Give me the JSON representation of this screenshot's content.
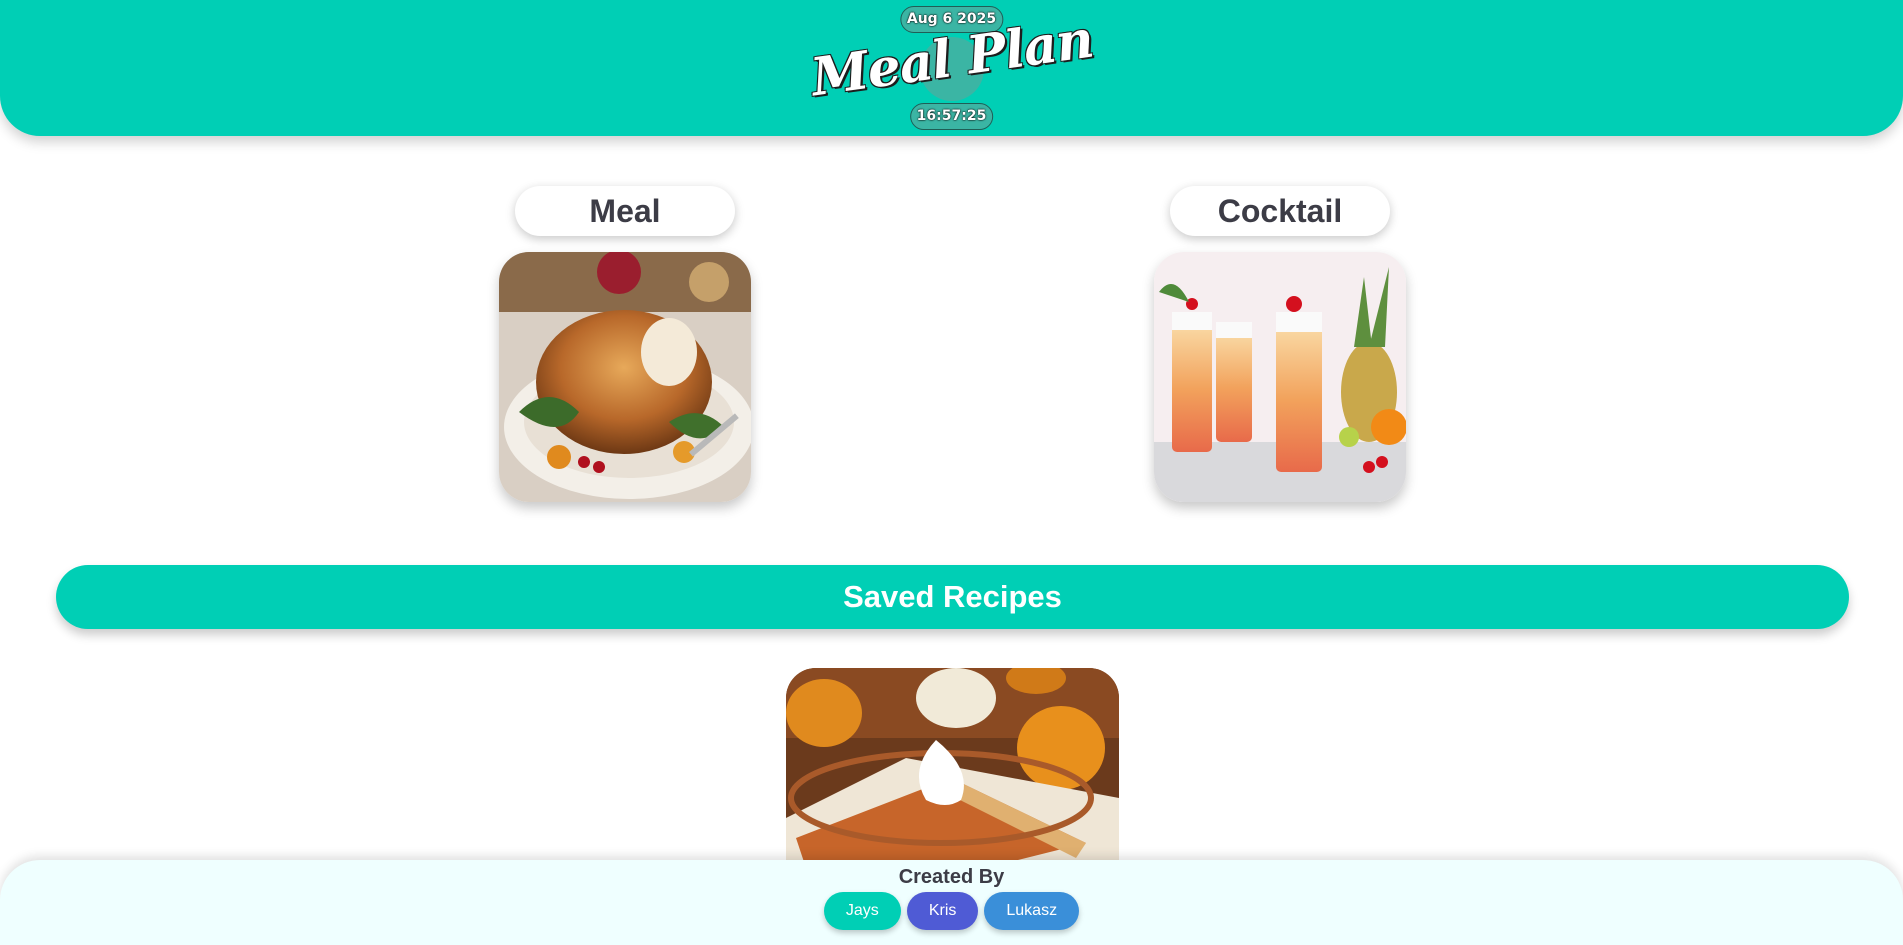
{
  "header": {
    "date": "Aug 6 2025",
    "logo": "Meal Plan",
    "time": "16:57:25",
    "color": "#00cfb5"
  },
  "categories": [
    {
      "label": "Meal",
      "image": "roast-turkey-photo"
    },
    {
      "label": "Cocktail",
      "image": "tropical-cocktails-photo"
    }
  ],
  "saved": {
    "title": "Saved Recipes",
    "items": [
      {
        "image": "pumpkin-pie-photo"
      }
    ]
  },
  "footer": {
    "label": "Created By",
    "authors": [
      {
        "name": "Jays",
        "color": "#00cfb5"
      },
      {
        "name": "Kris",
        "color": "#4f5bd5"
      },
      {
        "name": "Lukasz",
        "color": "#3a8fd9"
      }
    ]
  }
}
